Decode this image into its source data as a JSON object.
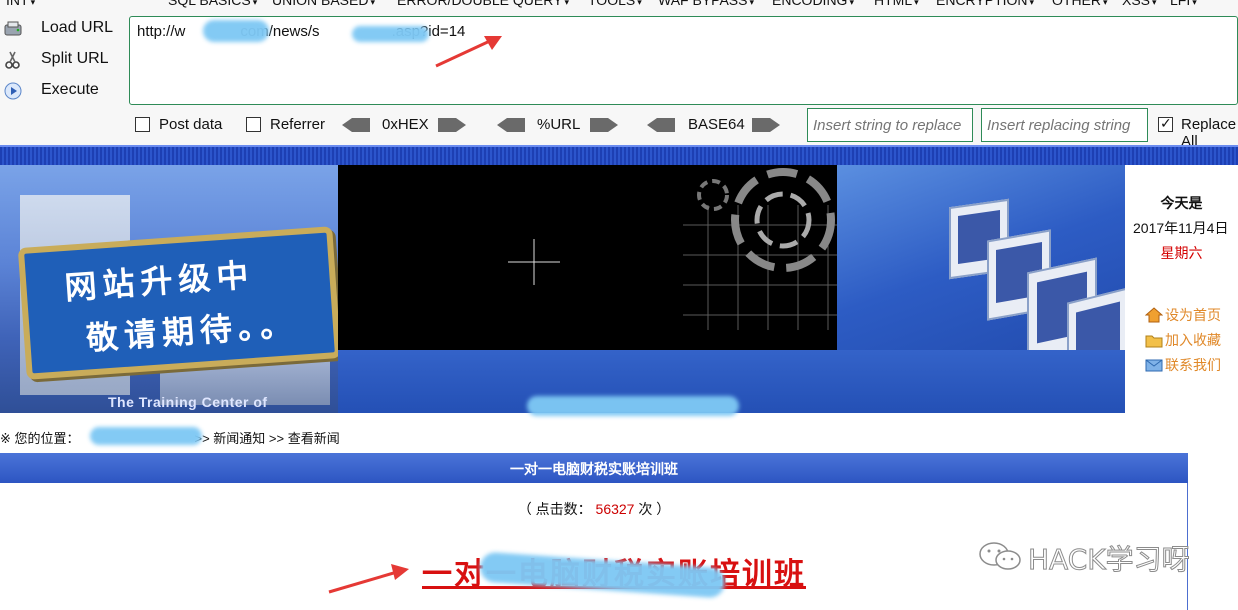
{
  "hackbar": {
    "menu": [
      "INT",
      "SQL BASICS",
      "UNION BASED",
      "ERROR/DOUBLE QUERY",
      "TOOLS",
      "WAF BYPASS",
      "ENCODING",
      "HTML",
      "ENCRYPTION",
      "OTHER",
      "XSS",
      "LFI"
    ],
    "load_url": "Load URL",
    "split_url": "Split URL",
    "execute": "Execute",
    "url_start": "http://w",
    "url_mid": "com/news/s",
    "url_end": ".asp?id=14",
    "post_data": "Post data",
    "referrer": "Referrer",
    "enc_hex": "0xHEX",
    "enc_url": "%URL",
    "enc_b64": "BASE64",
    "insert_placeholder": "Insert string to replace",
    "replacing_placeholder": "Insert replacing string",
    "replace_all": "Replace All"
  },
  "site": {
    "sign_line1": "网站升级中",
    "sign_line2": "敬请期待。。",
    "center_caption": "The Training Center of Accounting",
    "today_title": "今天是",
    "today_date": "2017年11月4日",
    "today_week": "星期六",
    "link_home": "设为首页",
    "link_fav": "加入收藏",
    "link_contact": "联系我们",
    "breadcrumb_prefix": "※ 您的位置：",
    "breadcrumb_rest": ">> 新闻通知 >> 查看新闻",
    "article_header": "一对一电脑财税实账培训班",
    "hits_label": "（ 点击数：",
    "hits_value": "56327",
    "hits_unit": "次 ）",
    "news_title": "一对一电脑财税实账培训班"
  },
  "watermark": "HACK学习呀",
  "colors": {
    "accent_green": "#2e8b57",
    "site_blue": "#2d55c2",
    "alert_red": "#d81010",
    "link_orange": "#e0892a"
  }
}
